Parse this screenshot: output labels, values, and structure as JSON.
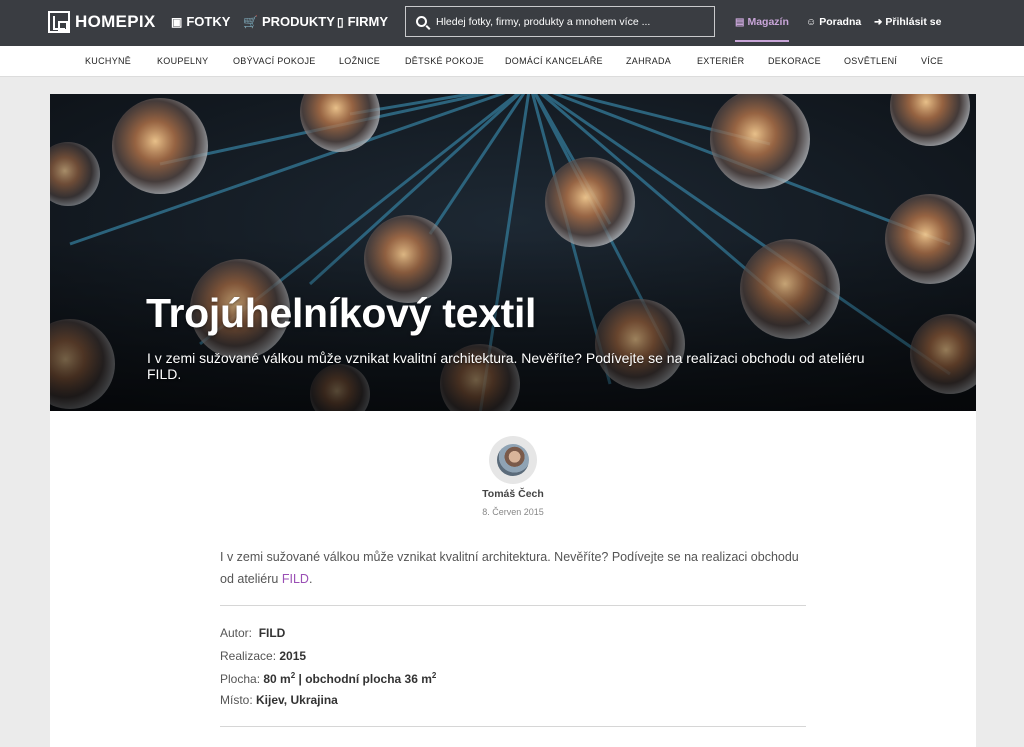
{
  "header": {
    "logo_text": "HOMEPIX",
    "nav": [
      {
        "label": "FOTKY",
        "icon": "image-icon"
      },
      {
        "label": "PRODUKTY",
        "icon": "cart-icon"
      },
      {
        "label": "FIRMY",
        "icon": "phone-icon"
      }
    ],
    "search_placeholder": "Hledej fotky, firmy, produkty a mnohem více ...",
    "right_nav": [
      {
        "label": "Magazín",
        "icon": "magazine-icon",
        "active": true
      },
      {
        "label": "Poradna",
        "icon": "smiley-icon"
      },
      {
        "label": "Přihlásit se",
        "icon": "login-icon"
      }
    ],
    "accent_color": "#c8a5d8"
  },
  "categories": [
    "KUCHYNĚ",
    "KOUPELNY",
    "OBÝVACÍ POKOJE",
    "LOŽNICE",
    "DĚTSKÉ POKOJE",
    "DOMÁCÍ KANCELÁŘE",
    "ZAHRADA",
    "EXTERIÉR",
    "DEKORACE",
    "OSVĚTLENÍ",
    "VÍCE"
  ],
  "article": {
    "title": "Trojúhelníkový textil",
    "subtitle": "I v zemi sužované válkou může vznikat kvalitní architektura. Nevěříte? Podívejte se na realizaci obchodu od ateliéru FILD.",
    "author": "Tomáš Čech",
    "date": "8. Červen 2015",
    "intro_text": "I v zemi sužované válkou může vznikat kvalitní architektura. Nevěříte? Podívejte se na realizaci obchodu od ateliéru ",
    "intro_link": "FILD",
    "intro_end": ".",
    "meta": {
      "autor_label": "Autor:",
      "autor_value": "FILD",
      "realizace_label": "Realizace:",
      "realizace_value": "2015",
      "plocha_label": "Plocha:",
      "plocha_value": "80 m",
      "plocha_sep": " | obchodní plocha 36 m",
      "sup": "2",
      "misto_label": "Místo:",
      "misto_value": "Kijev, Ukrajina"
    },
    "link_color": "#9a4fb5"
  }
}
